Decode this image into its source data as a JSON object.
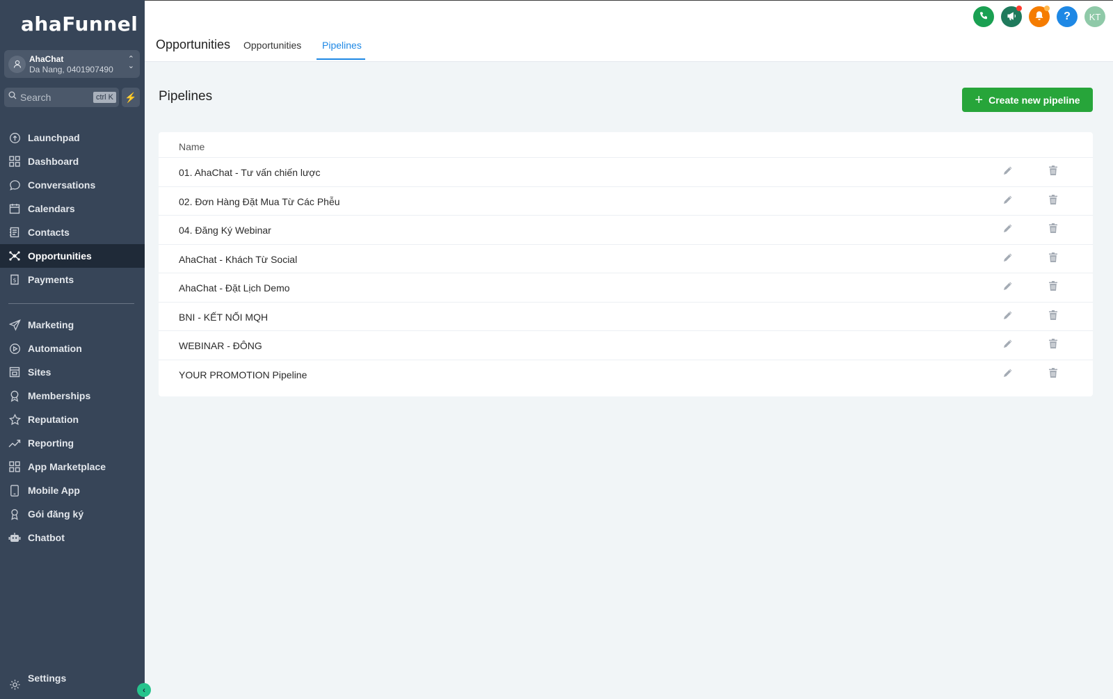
{
  "brand": {
    "logo": "ahaFunnel"
  },
  "account": {
    "name": "AhaChat",
    "location": "Da Nang, 0401907490"
  },
  "search": {
    "placeholder": "Search",
    "shortcut": "ctrl K"
  },
  "nav": {
    "items": [
      {
        "label": "Launchpad",
        "icon": "launchpad-icon"
      },
      {
        "label": "Dashboard",
        "icon": "dashboard-icon"
      },
      {
        "label": "Conversations",
        "icon": "chat-bubble-icon"
      },
      {
        "label": "Calendars",
        "icon": "calendar-icon"
      },
      {
        "label": "Contacts",
        "icon": "contacts-icon"
      },
      {
        "label": "Opportunities",
        "icon": "opportunities-icon",
        "active": true
      },
      {
        "label": "Payments",
        "icon": "payments-icon"
      },
      {
        "label": "Marketing",
        "icon": "send-icon"
      },
      {
        "label": "Automation",
        "icon": "automation-icon"
      },
      {
        "label": "Sites",
        "icon": "sites-icon"
      },
      {
        "label": "Memberships",
        "icon": "badge-icon"
      },
      {
        "label": "Reputation",
        "icon": "star-icon"
      },
      {
        "label": "Reporting",
        "icon": "trend-icon"
      },
      {
        "label": "App Marketplace",
        "icon": "grid-icon"
      },
      {
        "label": "Mobile App",
        "icon": "mobile-icon"
      },
      {
        "label": "Gói đăng ký",
        "icon": "award-icon"
      },
      {
        "label": "Chatbot",
        "icon": "robot-icon"
      }
    ],
    "settings": "Settings"
  },
  "header": {
    "title": "Opportunities",
    "tabs": [
      {
        "label": "Opportunities",
        "active": false
      },
      {
        "label": "Pipelines",
        "active": true
      }
    ],
    "avatar_initials": "KT",
    "help_symbol": "?"
  },
  "colors": {
    "sidebar": "#374558",
    "accent": "#1e88e5",
    "primary_button": "#27a53a"
  },
  "main": {
    "title": "Pipelines",
    "create_button": "Create new pipeline",
    "table": {
      "column_name": "Name",
      "rows": [
        "01. AhaChat - Tư vấn chiến lược",
        "02. Đơn Hàng Đặt Mua Từ Các Phễu",
        "04. Đăng Ký Webinar",
        "AhaChat - Khách Từ Social",
        "AhaChat - Đặt Lịch Demo",
        "BNI - KẾT NỐI MQH",
        "WEBINAR - ĐÔNG",
        "YOUR PROMOTION Pipeline"
      ]
    }
  }
}
